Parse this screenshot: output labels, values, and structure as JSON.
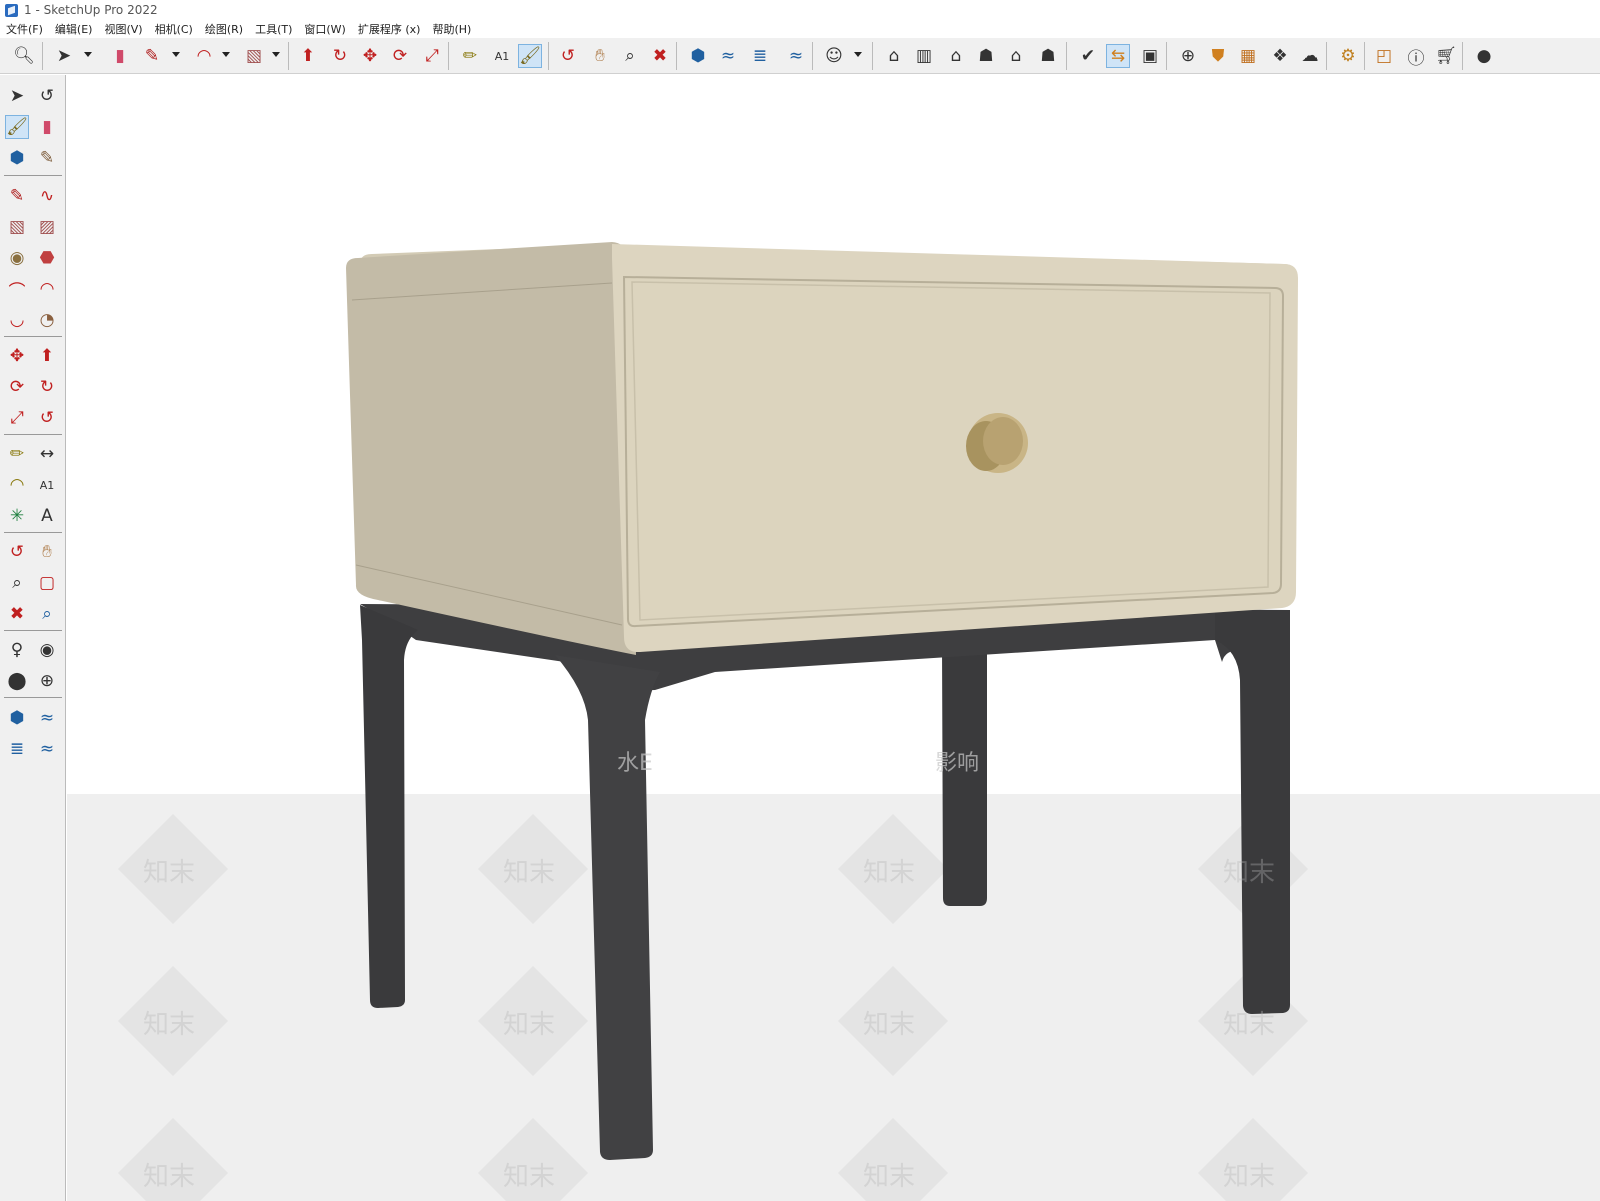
{
  "window": {
    "title": "1 - SketchUp Pro 2022"
  },
  "menu": [
    "文件(F)",
    "编辑(E)",
    "视图(V)",
    "相机(C)",
    "绘图(R)",
    "工具(T)",
    "窗口(W)",
    "扩展程序 (x)",
    "帮助(H)"
  ],
  "toolbar": {
    "icons": [
      "zoom-window-icon",
      "select-icon",
      "eraser-icon",
      "pencil-icon",
      "arc-icon",
      "rectangle-icon",
      "push-pull-icon",
      "follow-me-icon",
      "move-icon",
      "rotate-icon",
      "scale-icon",
      "tape-measure-icon",
      "text-icon",
      "paint-bucket-icon",
      "orbit-icon",
      "pan-icon",
      "zoom-icon",
      "zoom-extents-icon",
      "trimble-connect-icon",
      "sandbox-icon",
      "layers-icon",
      "component-options-icon",
      "profile-icon",
      "iso-view-icon",
      "right-view-icon",
      "front-view-icon",
      "back-view-icon",
      "top-view-icon",
      "left-view-icon",
      "bottom-view-icon",
      "style-icon",
      "section-icon",
      "scene-icon",
      "add-location-icon",
      "shadow-icon",
      "3d-warehouse-icon",
      "extension-warehouse-icon",
      "share-model-icon",
      "model-info-icon",
      "layout-icon",
      "info-icon",
      "cart-icon",
      "account-icon"
    ]
  },
  "left_toolbar": {
    "icons": [
      "select-icon",
      "orbit-icon",
      "paint-bucket-icon",
      "eraser-icon",
      "component-icon",
      "tag-icon",
      "pencil-icon",
      "freehand-icon",
      "rectangle-icon",
      "rotated-rectangle-icon",
      "circle-icon",
      "polygon-icon",
      "arc-icon",
      "two-point-arc-icon",
      "three-point-arc-icon",
      "pie-icon",
      "move-icon",
      "push-pull-icon",
      "rotate-icon",
      "follow-me-icon",
      "scale-icon",
      "offset-icon",
      "tape-measure-icon",
      "dimension-icon",
      "protractor-icon",
      "text-icon",
      "axes-icon",
      "3d-text-icon",
      "orbit-2-icon",
      "pan-icon",
      "zoom-icon",
      "zoom-window-icon",
      "zoom-extents-icon",
      "previous-view-icon",
      "position-camera-icon",
      "look-around-icon",
      "walk-icon",
      "section-plane-icon",
      "trimble-connect-icon",
      "sandbox-icon",
      "layers-icon",
      "component-options-icon"
    ]
  },
  "watermark": {
    "text": "知末",
    "banner": "水印影响",
    "fragments": [
      "水E",
      "影响"
    ]
  },
  "colors": {
    "cabinet": "#ddd5c0",
    "cabinet_side": "#c3bba7",
    "handle": "#b7a275",
    "legs": "#3e3e40",
    "floor": "#efefef"
  }
}
